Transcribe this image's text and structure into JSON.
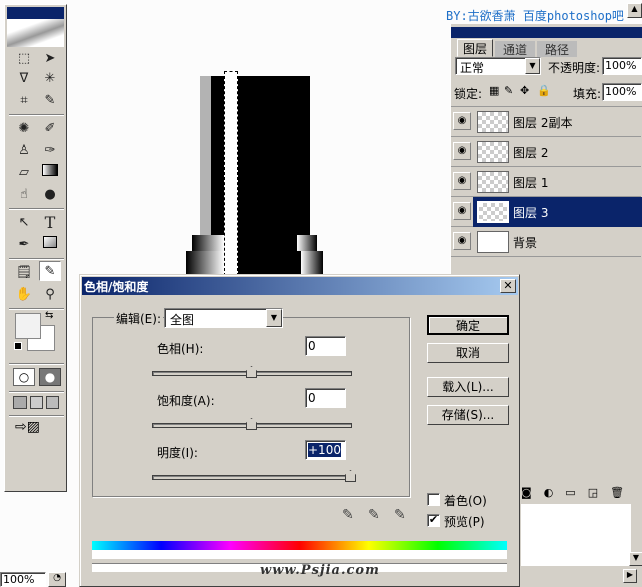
{
  "watermark_top": "BY:古欲香萧  百度photoshop吧",
  "watermark_bottom": "www.Psjia.com",
  "toolbox": {
    "tools": [
      "marquee-icon",
      "move-icon",
      "lasso-icon",
      "magic-wand-icon",
      "crop-icon",
      "slice-icon",
      "healing-icon",
      "brush-icon",
      "stamp-icon",
      "history-brush-icon",
      "eraser-icon",
      "gradient-icon",
      "smudge-icon",
      "dodge-icon",
      "path-select-icon",
      "type-icon",
      "pen-icon",
      "shape-icon",
      "notes-icon",
      "eyedropper-icon",
      "hand-icon",
      "zoom-icon"
    ],
    "type_glyph": "T"
  },
  "status": {
    "zoom": "100%"
  },
  "layers_panel": {
    "tabs": [
      "图层",
      "通道",
      "路径"
    ],
    "blend_mode": "正常",
    "opacity_label": "不透明度:",
    "opacity": "100%",
    "lock_label": "锁定:",
    "fill_label": "填充:",
    "fill": "100%",
    "layers": [
      {
        "name": "图层 2副本",
        "selected": false
      },
      {
        "name": "图层 2",
        "selected": false
      },
      {
        "name": "图层 1",
        "selected": false
      },
      {
        "name": "图层 3",
        "selected": true
      },
      {
        "name": "背景",
        "selected": false
      }
    ]
  },
  "dialog": {
    "title": "色相/饱和度",
    "edit_label": "编辑(E):",
    "edit_value": "全图",
    "hue_label": "色相(H):",
    "hue_value": "0",
    "hue": 0,
    "saturation_label": "饱和度(A):",
    "saturation_value": "0",
    "saturation": 0,
    "lightness_label": "明度(I):",
    "lightness_value": "+100",
    "lightness": 100,
    "ok": "确定",
    "cancel": "取消",
    "load": "载入(L)...",
    "save": "存储(S)...",
    "colorize_label": "着色(O)",
    "colorize": false,
    "preview_label": "预览(P)",
    "preview": true
  },
  "colors": {
    "title_bar": "#0a246a",
    "selection": "#0a246a",
    "face": "#d4d0c8"
  }
}
